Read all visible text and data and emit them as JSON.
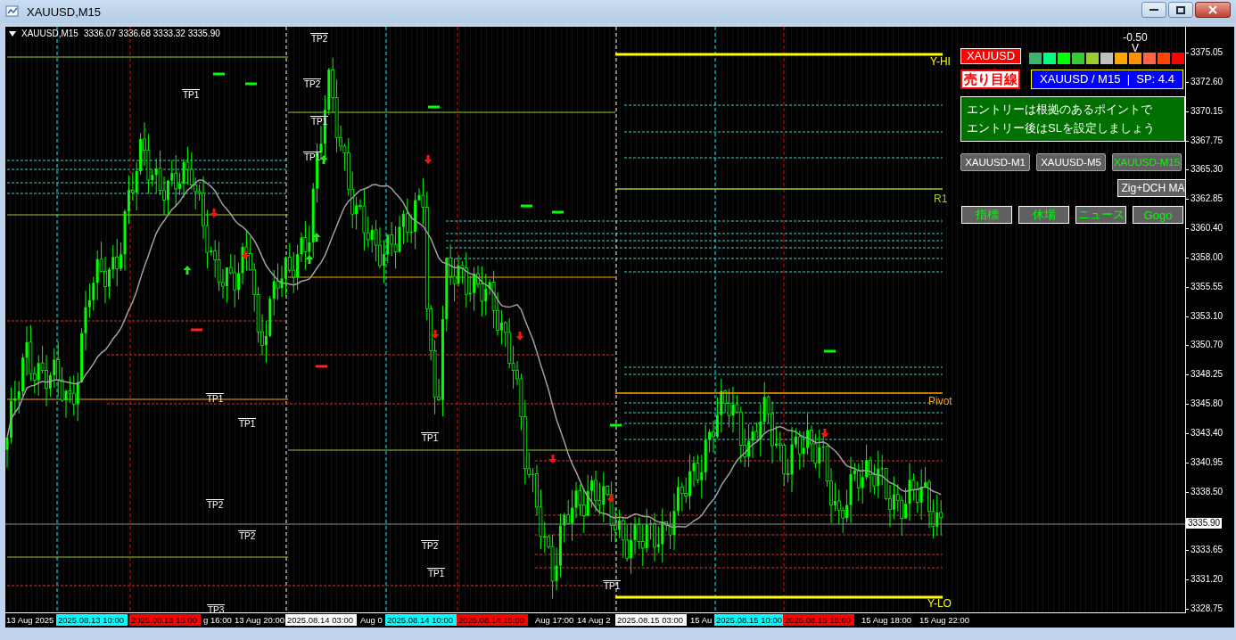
{
  "window": {
    "title": "XAUUSD,M15"
  },
  "chart_header": {
    "symbol": "XAUUSD,M15",
    "ohlc": "3336.07 3336.68 3333.32 3335.90"
  },
  "levels": [
    {
      "label": "Y-HI",
      "color": "#ffff00"
    },
    {
      "label": "R1",
      "color": "#9acd32"
    },
    {
      "label": "Pivot",
      "color": "#ffa500"
    },
    {
      "label": "Y-LO",
      "color": "#fffe00"
    }
  ],
  "tp_markers": [
    {
      "label": "TP2"
    },
    {
      "label": "TP1"
    },
    {
      "label": "TP2"
    },
    {
      "label": "TP1"
    },
    {
      "label": "TP1"
    },
    {
      "label": "TP1"
    },
    {
      "label": "TP1"
    },
    {
      "label": "TP1"
    },
    {
      "label": "TP2"
    },
    {
      "label": "TP2"
    },
    {
      "label": "TP2"
    },
    {
      "label": "TP1"
    },
    {
      "label": "TP1"
    },
    {
      "label": "TP3"
    }
  ],
  "panel": {
    "symbol": "XAUUSD",
    "strength_value": "-0.50",
    "pointer": "V",
    "strength_cells": [
      {
        "color": "#3cb371",
        "selected": false
      },
      {
        "color": "#00ff7f",
        "selected": false
      },
      {
        "color": "#00ff00",
        "selected": false
      },
      {
        "color": "#32cd32",
        "selected": false
      },
      {
        "color": "#9acd32",
        "selected": false
      },
      {
        "color": "#c0c0c0",
        "selected": false
      },
      {
        "color": "#ffa500",
        "selected": false
      },
      {
        "color": "#ff9000",
        "selected": true
      },
      {
        "color": "#ff6347",
        "selected": false
      },
      {
        "color": "#ff4500",
        "selected": false
      },
      {
        "color": "#ff0000",
        "selected": false
      }
    ],
    "bias": "売り目線",
    "info": "XAUUSD / M15  |  SP: 4.4",
    "message": [
      "エントリーは根拠のあるポイントで",
      "エントリー後はSLを設定しましょう"
    ],
    "timeframes": [
      {
        "label": "XAUUSD-M1",
        "selected": false
      },
      {
        "label": "XAUUSD-M5",
        "selected": false
      },
      {
        "label": "XAUUSD-M15",
        "selected": true
      }
    ],
    "indicator_button": "Zig+DCH MA",
    "tools": [
      "指標",
      "休場",
      "ニュース",
      "Gogo"
    ]
  },
  "price_axis": [
    "3375.05",
    "3372.60",
    "3370.15",
    "3367.75",
    "3365.30",
    "3362.85",
    "3360.40",
    "3358.00",
    "3355.55",
    "3353.10",
    "3350.70",
    "3348.25",
    "3345.80",
    "3343.40",
    "3340.95",
    "3338.50",
    "3333.65",
    "3331.20",
    "3328.75"
  ],
  "current_price": "3335.90",
  "time_axis": [
    {
      "label": "13 Aug 2025"
    },
    {
      "label": "2025.08.13 10:00",
      "color": "#00ffff"
    },
    {
      "label": "2025.08.13 15:00",
      "color": "#ff0000"
    },
    {
      "label": "g 16:00"
    },
    {
      "label": "13 Aug 20:00"
    },
    {
      "label": "2025.08.14 03:00",
      "color": "#ffffff"
    },
    {
      "label": "Aug 0"
    },
    {
      "label": "2025.08.14 10:00",
      "color": "#00fffe"
    },
    {
      "label": "2025.08.14 15:00",
      "color": "#fe0000"
    },
    {
      "label": "Aug 17:00"
    },
    {
      "label": "14 Aug 2"
    },
    {
      "label": "2025.08.15 03:00",
      "color": "#fffffe"
    },
    {
      "label": "15 Au"
    },
    {
      "label": "2025.08.15 10:00",
      "color": "#00fefe"
    },
    {
      "label": "2025.08.15 15:00",
      "color": "#fe0001"
    },
    {
      "label": "15 Aug 18:00"
    },
    {
      "label": "15 Aug 22:00"
    }
  ]
}
